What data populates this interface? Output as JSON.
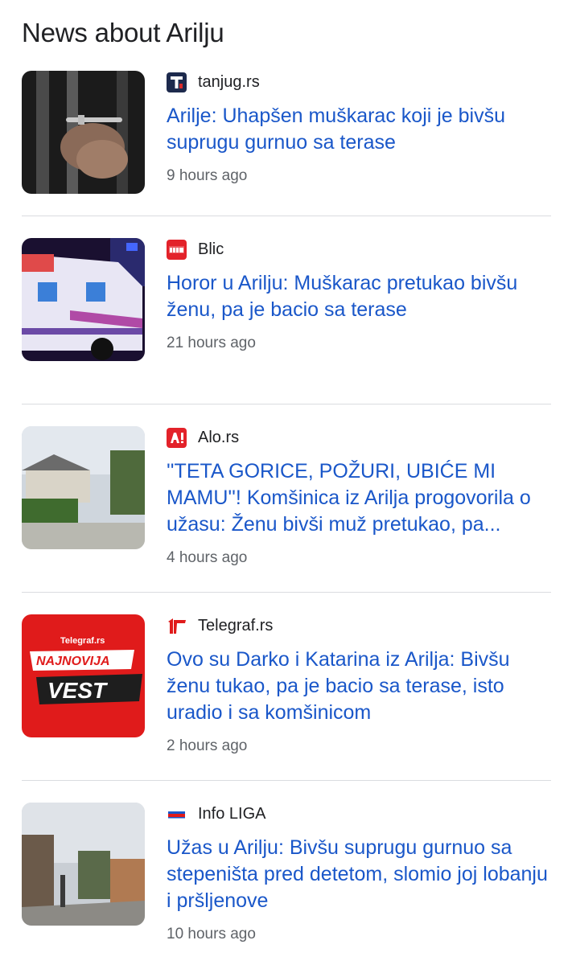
{
  "header": {
    "title": "News about Arilju"
  },
  "articles": [
    {
      "source": "tanjug.rs",
      "favicon": "tanjug-logo-icon",
      "headline": "Arilje: Uhapšen muškarac koji je bivšu suprugu gurnuo sa terase",
      "time": "9 hours ago",
      "thumbnail": "handcuffs-photo"
    },
    {
      "source": "Blic",
      "favicon": "blic-logo-icon",
      "headline": "Horor u Arilju: Muškarac pretukao bivšu ženu, pa je bacio sa terase",
      "time": "21 hours ago",
      "thumbnail": "ambulance-photo"
    },
    {
      "source": "Alo.rs",
      "favicon": "alo-logo-icon",
      "headline": "''TETA GORICE, POŽURI, UBIĆE MI MAMU''! Komšinica iz Arilja progovorila o užasu: Ženu bivši muž pretukao, pa...",
      "time": "4 hours ago",
      "thumbnail": "house-photo"
    },
    {
      "source": "Telegraf.rs",
      "favicon": "telegraf-logo-icon",
      "headline": "Ovo su Darko i Katarina iz Arilja: Bivšu ženu tukao, pa je bacio sa terase, isto uradio i sa komšinicom",
      "time": "2 hours ago",
      "thumbnail": "najnovija-vest-graphic",
      "thumbnail_text": {
        "brand": "Telegraf.rs",
        "line1": "NAJNOVIJA",
        "line2": "VEST"
      }
    },
    {
      "source": "Info LIGA",
      "favicon": "info-liga-logo-icon",
      "headline": "Užas u Arilju: Bivšu suprugu gurnuo sa stepeništa pred detetom, slomio joj lobanju i pršljenove",
      "time": "10 hours ago",
      "thumbnail": "town-street-photo"
    }
  ],
  "colors": {
    "headline_link": "#1a57c9",
    "source_text": "#202124",
    "timestamp": "#5f6368",
    "divider": "#dadce0"
  }
}
